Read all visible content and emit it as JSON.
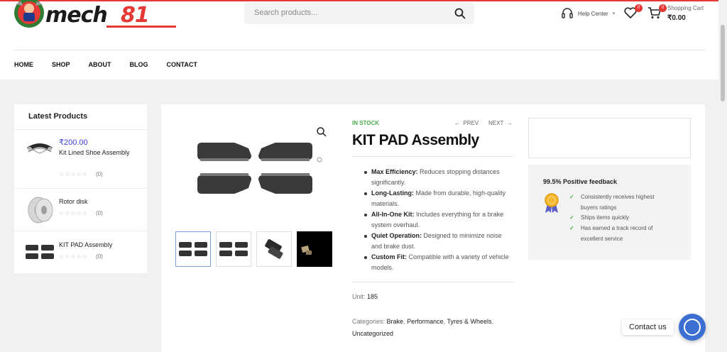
{
  "header": {
    "logo_text": "mech81",
    "search_placeholder": "Search products...",
    "help_label": "Help Center",
    "wishlist_count": "0",
    "cart_count": "0",
    "cart_label": "Shopping Cart",
    "cart_total": "₹0.00"
  },
  "nav": [
    "HOME",
    "SHOP",
    "ABOUT",
    "BLOG",
    "CONTACT"
  ],
  "sidebar": {
    "title": "Latest Products",
    "products": [
      {
        "price": "₹200.00",
        "name": "Kit Lined Shoe Assembly",
        "count": "(0)",
        "stars": "☆☆☆☆☆"
      },
      {
        "price": "",
        "name": "Rotor disk",
        "count": "(0)",
        "stars": "☆☆☆☆☆"
      },
      {
        "price": "",
        "name": "KIT PAD Assembly",
        "count": "(0)",
        "stars": "☆☆☆☆☆"
      }
    ]
  },
  "product": {
    "stock": "IN STOCK",
    "prev": "PREV",
    "next": "NEXT",
    "title": "KIT PAD Assembly",
    "features": [
      {
        "label": "Max Efficiency:",
        "text": "Reduces stopping distances significantly."
      },
      {
        "label": "Long-Lasting:",
        "text": "Made from durable, high-quality materials."
      },
      {
        "label": "All-In-One Kit:",
        "text": "Includes everything for a brake system overhaul."
      },
      {
        "label": "Quiet Operation:",
        "text": "Designed to minimize noise and brake dust."
      },
      {
        "label": "Custom Fit:",
        "text": "Compatible with a variety of vehicle models."
      }
    ],
    "unit_label": "Unit:",
    "unit_value": "185",
    "categories_label": "Categories:",
    "categories": [
      "Brake",
      "Performance",
      "Tyres & Wheels",
      "Uncategorized"
    ]
  },
  "feedback": {
    "title": "99.5% Positive feedback",
    "items": [
      "Consistently receives highest buyers ratings",
      "Ships items quickly",
      "Has earned a track record of excellent service"
    ]
  },
  "chat": {
    "label": "Contact us"
  },
  "colors": {
    "accent": "#e53935",
    "price": "#3b3fd8",
    "stock": "#4cae4c",
    "chat": "#3b6fd1"
  }
}
